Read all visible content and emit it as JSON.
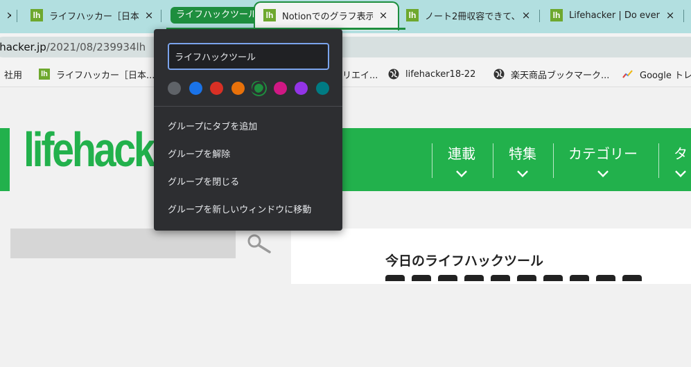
{
  "tabs": [
    {
      "label": "ライフハッカー［日本版］",
      "favicon": "lh",
      "close": "×"
    },
    {
      "label": "Notionでのグラフ表示",
      "favicon": "lh",
      "close": "×",
      "active": true
    },
    {
      "label": "ノート2冊収容できて、",
      "favicon": "lh",
      "close": "×"
    },
    {
      "label": "Lifehacker | Do everything better",
      "favicon": "lh",
      "close": "×"
    }
  ],
  "left_tab_close": "×",
  "tab_group": {
    "name": "ライフハックツール",
    "color": "#1e8e3e"
  },
  "address": {
    "host": "ehacker.jp",
    "path": "/2021/08/239934lh"
  },
  "bookmarks": [
    {
      "label": "社用",
      "icon": "none"
    },
    {
      "label": "ライフハッカー［日本...",
      "icon": "lh"
    },
    {
      "label": "リエイ...",
      "icon": "none"
    },
    {
      "label": "lifehacker18-22",
      "icon": "globe-icon"
    },
    {
      "label": "楽天商品ブックマーク...",
      "icon": "globe-icon"
    },
    {
      "label": "Google トレ",
      "icon": "trends-icon"
    }
  ],
  "menu": {
    "group_name_value": "ライフハックツール",
    "colors": [
      "#5f6368",
      "#1a73e8",
      "#d93025",
      "#e8710a",
      "#1e8e3e",
      "#d01884",
      "#9334e6",
      "#007b83"
    ],
    "selected_color": "#1e8e3e",
    "items": [
      "グループにタブを追加",
      "グループを解除",
      "グループを閉じる",
      "グループを新しいウィンドウに移動"
    ]
  },
  "site": {
    "logo": "lifehacker",
    "nav": [
      "連載",
      "特集",
      "カテゴリー",
      "タ"
    ],
    "brand_color": "#22b14c",
    "card_title": "今日のライフハックツール"
  }
}
